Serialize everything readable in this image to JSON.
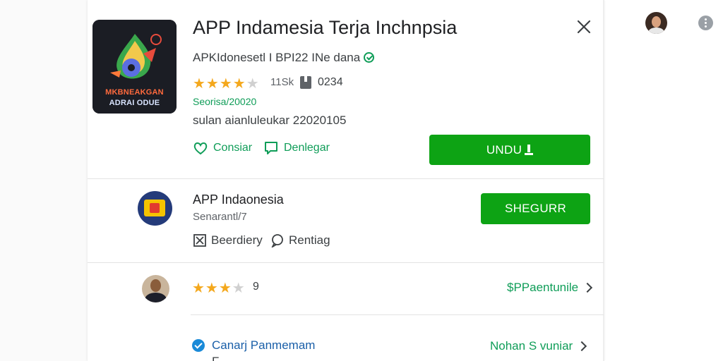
{
  "window": {
    "close_label": "×"
  },
  "app": {
    "title": "APP Indamesia Terja Inchnpsia",
    "developer": "APKIdonesetl I BPI22  INe dana",
    "rating_stars": 4.5,
    "rating_count": "11Sk",
    "downloads": "0234",
    "category": "Seorisa/20020",
    "updated": "sulan aianluleukar 22020105",
    "icon_text_line1": "MKBNEAKGAN",
    "icon_text_line2": "ADRAI ODUE",
    "actions": {
      "share_label": "Consiar",
      "wishlist_label": "Denlegar"
    },
    "install_label": "UNDU"
  },
  "publisher": {
    "name": "APP Indaonesia",
    "subtitle": "Senarantl/7",
    "link1": "Beerdiery",
    "link2": "Rentiag",
    "follow_label": "SHEGURR"
  },
  "reviews": {
    "stars": 3.5,
    "count": "9",
    "link_label": "$PPaentunile"
  },
  "safety": {
    "title": "Canarj Panmemam",
    "link_label": "Nohan S vuniar",
    "cut_text": "F      "
  },
  "colors": {
    "accent_green": "#0da314",
    "link_green": "#0f9d58",
    "star": "#f4a81d",
    "blue": "#1a8ad8"
  },
  "icons": [
    "close-icon",
    "verified-icon",
    "star-icon",
    "downloads-icon",
    "heart-outline-icon",
    "chat-bubble-icon",
    "download-icon",
    "report-icon",
    "comment-icon",
    "chevron-right-icon",
    "check-circle-icon",
    "more-vert-icon"
  ]
}
